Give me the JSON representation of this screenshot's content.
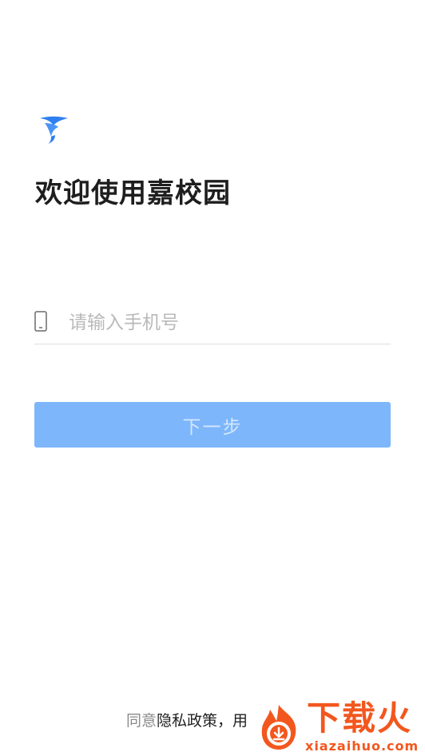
{
  "header": {
    "logo_icon": "app-logo-icon",
    "title": "欢迎使用嘉校园"
  },
  "login": {
    "phone_icon": "phone-icon",
    "phone_placeholder": "请输入手机号",
    "phone_value": "",
    "next_button_label": "下一步"
  },
  "footer": {
    "agree_prefix": "同意",
    "privacy_link": "隐私政策",
    "separator": "，",
    "user_link_partial": "用"
  },
  "watermark": {
    "name": "下载火",
    "url": "xiazaihuo.com"
  },
  "colors": {
    "accent": "#7db6fb",
    "button_text": "#d4e6fd",
    "logo_blue": "#2f7ff0",
    "watermark_orange": "#f2571e"
  }
}
